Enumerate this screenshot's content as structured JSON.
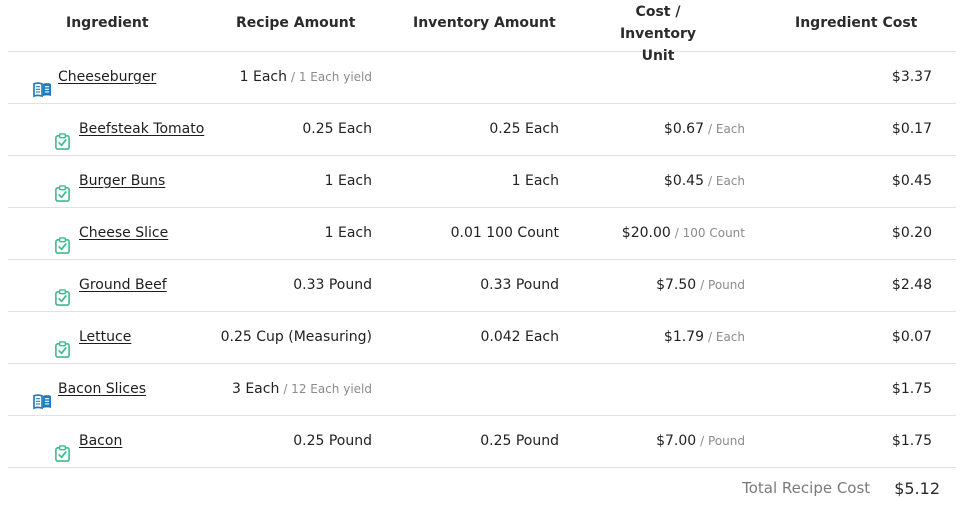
{
  "colors": {
    "recipe_icon": "#1f7bc1",
    "ingredient_icon": "#3dbb8a",
    "divider": "#e2e2e2"
  },
  "headers": {
    "ingredient": "Ingredient",
    "recipe_amount": "Recipe Amount",
    "inventory_amount": "Inventory Amount",
    "cost_per_unit_line1": "Cost / Inventory",
    "cost_per_unit_line2": "Unit",
    "ingredient_cost": "Ingredient Cost"
  },
  "rows": [
    {
      "type": "recipe",
      "icon": "book-icon",
      "name": "Cheeseburger",
      "recipe_amount": "1 Each",
      "recipe_note": "/ 1 Each yield",
      "inventory_amount": "",
      "cost": "",
      "cost_unit": "",
      "ingredient_cost": "$3.37"
    },
    {
      "type": "ingredient",
      "icon": "clipboard-check-icon",
      "name": "Beefsteak Tomato",
      "recipe_amount": "0.25 Each",
      "recipe_note": "",
      "inventory_amount": "0.25 Each",
      "cost": "$0.67",
      "cost_unit": "/ Each",
      "ingredient_cost": "$0.17"
    },
    {
      "type": "ingredient",
      "icon": "clipboard-check-icon",
      "name": "Burger Buns",
      "recipe_amount": "1 Each",
      "recipe_note": "",
      "inventory_amount": "1 Each",
      "cost": "$0.45",
      "cost_unit": "/ Each",
      "ingredient_cost": "$0.45"
    },
    {
      "type": "ingredient",
      "icon": "clipboard-check-icon",
      "name": "Cheese Slice",
      "recipe_amount": "1 Each",
      "recipe_note": "",
      "inventory_amount": "0.01 100 Count",
      "cost": "$20.00",
      "cost_unit": "/ 100 Count",
      "ingredient_cost": "$0.20"
    },
    {
      "type": "ingredient",
      "icon": "clipboard-check-icon",
      "name": "Ground Beef",
      "recipe_amount": "0.33 Pound",
      "recipe_note": "",
      "inventory_amount": "0.33 Pound",
      "cost": "$7.50",
      "cost_unit": "/ Pound",
      "ingredient_cost": "$2.48"
    },
    {
      "type": "ingredient",
      "icon": "clipboard-check-icon",
      "name": "Lettuce",
      "recipe_amount": "0.25 Cup (Measuring)",
      "recipe_note": "",
      "inventory_amount": "0.042 Each",
      "cost": "$1.79",
      "cost_unit": "/ Each",
      "ingredient_cost": "$0.07"
    },
    {
      "type": "recipe",
      "icon": "book-icon",
      "name": "Bacon Slices",
      "recipe_amount": "3 Each",
      "recipe_note": "/ 12 Each yield",
      "inventory_amount": "",
      "cost": "",
      "cost_unit": "",
      "ingredient_cost": "$1.75"
    },
    {
      "type": "ingredient",
      "icon": "clipboard-check-icon",
      "name": "Bacon",
      "recipe_amount": "0.25 Pound",
      "recipe_note": "",
      "inventory_amount": "0.25 Pound",
      "cost": "$7.00",
      "cost_unit": "/ Pound",
      "ingredient_cost": "$1.75"
    }
  ],
  "total": {
    "label": "Total Recipe Cost",
    "value": "$5.12"
  }
}
